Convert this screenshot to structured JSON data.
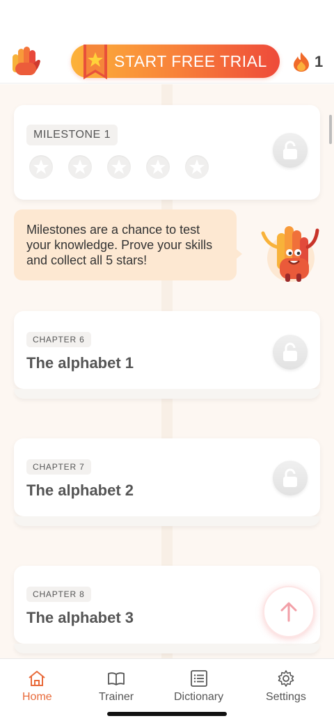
{
  "header": {
    "trial_button_label": "START FREE TRIAL",
    "streak_count": "1",
    "icons": {
      "logo": "hand-logo-icon",
      "ribbon": "star-ribbon-icon",
      "streak": "fire-icon"
    }
  },
  "milestone": {
    "badge": "MILESTONE 1",
    "stars_total": 5,
    "stars_earned": 0,
    "locked": true
  },
  "speech_bubble": {
    "line1": "Milestones are a chance to test",
    "line2": "your knowledge. Prove your skills",
    "line3": "and collect all 5 stars!"
  },
  "chapters": [
    {
      "badge": "CHAPTER 6",
      "title": "The alphabet 1",
      "locked": true
    },
    {
      "badge": "CHAPTER 7",
      "title": "The alphabet 2",
      "locked": true
    },
    {
      "badge": "CHAPTER 8",
      "title": "The alphabet 3",
      "locked": false
    }
  ],
  "nav": {
    "items": [
      {
        "label": "Home",
        "icon": "home-icon",
        "active": true
      },
      {
        "label": "Trainer",
        "icon": "book-icon",
        "active": false
      },
      {
        "label": "Dictionary",
        "icon": "list-icon",
        "active": false
      },
      {
        "label": "Settings",
        "icon": "gear-icon",
        "active": false
      }
    ]
  },
  "colors": {
    "accent": "#e86a3a",
    "trial_gradient": [
      "#fcb23a",
      "#f8823a",
      "#ee4a3a"
    ],
    "bubble": "#fde8d2",
    "background": "#fdf7f2"
  }
}
